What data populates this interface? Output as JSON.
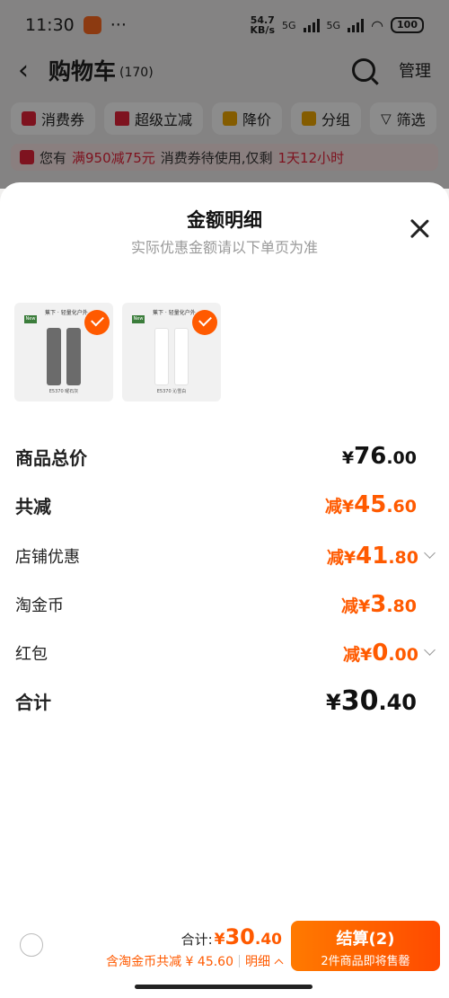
{
  "status_bar": {
    "time": "11:30",
    "more": "···",
    "speed_value": "54.7",
    "speed_unit": "KB/s",
    "net1": "5G",
    "net2": "5G",
    "battery": "100"
  },
  "nav": {
    "back": "‹",
    "title": "购物车",
    "count": "(170)",
    "manage": "管理"
  },
  "chips": [
    {
      "label": "消费券",
      "icon": "coupon-icon",
      "color": "#e6233a"
    },
    {
      "label": "超级立减",
      "icon": "down-arrow-icon",
      "color": "#e6233a"
    },
    {
      "label": "降价",
      "icon": "price-drop-icon",
      "color": "#f0a800"
    },
    {
      "label": "分组",
      "icon": "folder-icon",
      "color": "#f0a800"
    },
    {
      "label": "筛选",
      "icon": "filter-icon",
      "color": "#333333"
    }
  ],
  "promo": {
    "t1": "您有",
    "t2": "满950减75元",
    "t3": "消费券待使用,仅剩",
    "t4": "1天12小时"
  },
  "sheet": {
    "title": "金额明细",
    "subtitle": "实际优惠金额请以下单页为准",
    "products": [
      {
        "brand": "蕉下 · 轻量化户外",
        "badge": "New",
        "caption": "E5370 曜石灰",
        "sleeve_color": "#6b6b6b",
        "selected": true
      },
      {
        "brand": "蕉下 · 轻量化户外",
        "badge": "New",
        "caption": "E5370 沁雪白",
        "sleeve_color": "#ffffff",
        "selected": true
      }
    ],
    "rows": {
      "total": {
        "label": "商品总价",
        "prefix": "¥",
        "int": "76",
        "dec": ".00"
      },
      "discount": {
        "label": "共减",
        "prefix": "减¥",
        "int": "45",
        "dec": ".60"
      },
      "shop": {
        "label": "店铺优惠",
        "prefix": "减¥",
        "int": "41",
        "dec": ".80"
      },
      "coins": {
        "label": "淘金币",
        "prefix": "减¥",
        "int": "3",
        "dec": ".80"
      },
      "hongbao": {
        "label": "红包",
        "prefix": "减¥",
        "int": "0",
        "dec": ".00"
      },
      "sum": {
        "label": "合计",
        "prefix": "¥",
        "int": "30",
        "dec": ".40"
      }
    }
  },
  "bottom": {
    "total_label": "合计:",
    "prefix": "¥",
    "int": "30",
    "dec": ".40",
    "saving": "含淘金币共减 ¥ 45.60",
    "detail": "明细",
    "checkout": "结算(2)",
    "checkout_sub": "2件商品即将售罄"
  },
  "colors": {
    "accent": "#ff5a00",
    "promo_red": "#e6233a"
  }
}
